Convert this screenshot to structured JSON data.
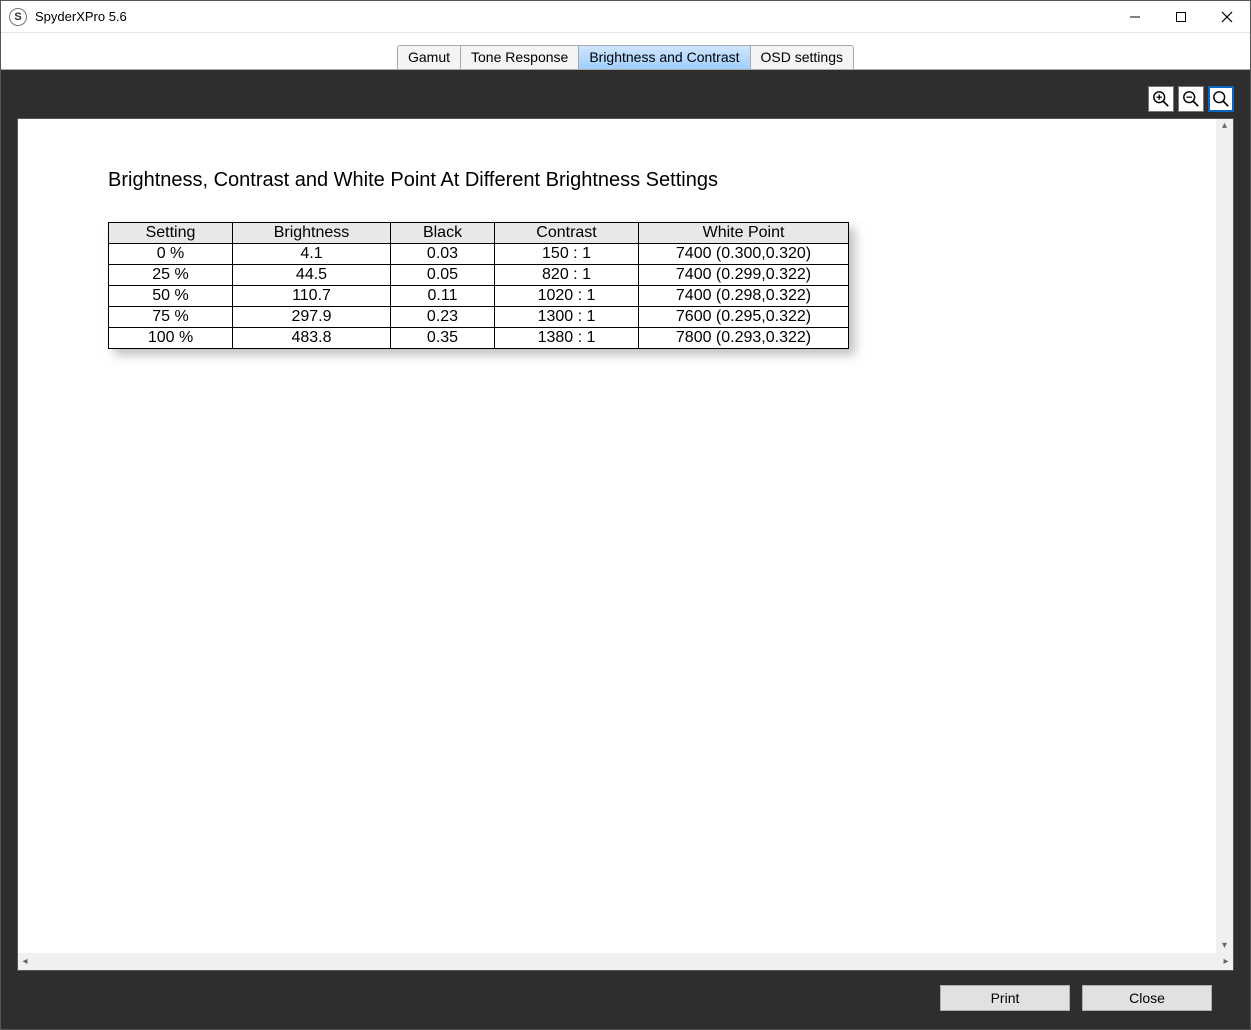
{
  "window": {
    "title": "SpyderXPro 5.6",
    "app_icon_letter": "S"
  },
  "tabs": [
    {
      "label": "Gamut"
    },
    {
      "label": "Tone Response"
    },
    {
      "label": "Brightness and Contrast"
    },
    {
      "label": "OSD settings"
    }
  ],
  "active_tab_index": 2,
  "page": {
    "heading": "Brightness, Contrast and White Point At Different Brightness Settings",
    "table": {
      "headers": [
        "Setting",
        "Brightness",
        "Black",
        "Contrast",
        "White Point"
      ],
      "rows": [
        {
          "setting": "0 %",
          "brightness": "4.1",
          "black": "0.03",
          "contrast": "150 : 1",
          "white_point": "7400 (0.300,0.320)"
        },
        {
          "setting": "25 %",
          "brightness": "44.5",
          "black": "0.05",
          "contrast": "820 : 1",
          "white_point": "7400 (0.299,0.322)"
        },
        {
          "setting": "50 %",
          "brightness": "110.7",
          "black": "0.11",
          "contrast": "1020 : 1",
          "white_point": "7400 (0.298,0.322)"
        },
        {
          "setting": "75 %",
          "brightness": "297.9",
          "black": "0.23",
          "contrast": "1300 : 1",
          "white_point": "7600 (0.295,0.322)"
        },
        {
          "setting": "100 %",
          "brightness": "483.8",
          "black": "0.35",
          "contrast": "1380 : 1",
          "white_point": "7800 (0.293,0.322)"
        }
      ]
    }
  },
  "footer": {
    "print_label": "Print",
    "close_label": "Close"
  }
}
